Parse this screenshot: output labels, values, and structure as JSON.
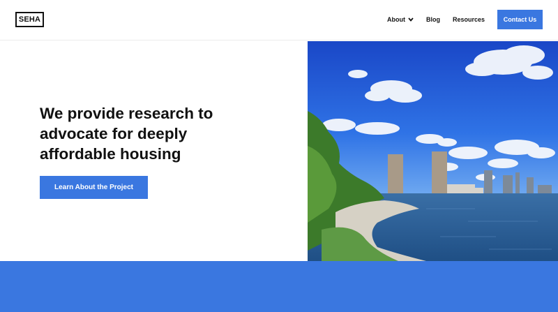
{
  "header": {
    "logo_text": "SEHA",
    "nav": {
      "about_label": "About",
      "blog_label": "Blog",
      "resources_label": "Resources",
      "contact_label": "Contact Us"
    }
  },
  "hero": {
    "headline": "We provide research to\nadvocate for deeply\naffordable housing",
    "cta_label": "Learn About the Project"
  },
  "colors": {
    "accent": "#3a77e0",
    "text": "#111111",
    "background": "#ffffff"
  },
  "icons": {
    "about_dropdown": "chevron-down-icon"
  }
}
